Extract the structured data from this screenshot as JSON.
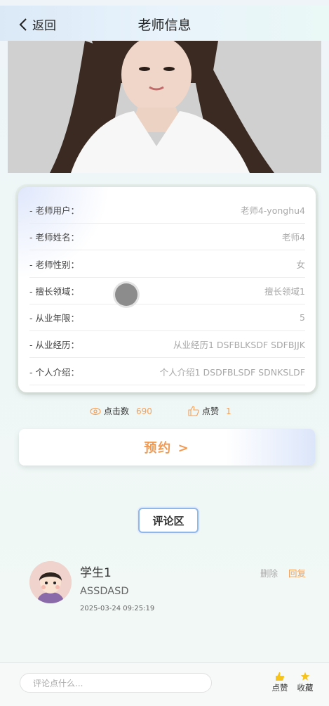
{
  "header": {
    "back_label": "返回",
    "title": "老师信息"
  },
  "info": {
    "rows": [
      {
        "key": "- 老师用户：",
        "value": "老师4-yonghu4"
      },
      {
        "key": "- 老师姓名：",
        "value": "老师4"
      },
      {
        "key": "- 老师性别：",
        "value": "女"
      },
      {
        "key": "- 擅长领域：",
        "value": "擅长领域1"
      },
      {
        "key": "- 从业年限：",
        "value": "5"
      },
      {
        "key": "- 从业经历：",
        "value": "从业经历1 DSFBLKSDF SDFBJJK"
      },
      {
        "key": "- 个人介绍：",
        "value": "个人介绍1 DSDFBLSDF SDNKSLDF"
      }
    ]
  },
  "stats": {
    "clicks_label": "点击数",
    "clicks_value": "690",
    "likes_label": "点赞",
    "likes_value": "1"
  },
  "booking": {
    "label": "预约 >"
  },
  "comments": {
    "section_label": "评论区",
    "items": [
      {
        "user": "学生1",
        "text": "ASSDASD",
        "time": "2025-03-24 09:25:19",
        "delete_label": "删除",
        "reply_label": "回复"
      }
    ]
  },
  "bottom": {
    "placeholder": "评论点什么...",
    "like_label": "点赞",
    "collect_label": "收藏"
  },
  "colors": {
    "accent": "#f2a05a",
    "primary_border": "#8fb7ea"
  }
}
